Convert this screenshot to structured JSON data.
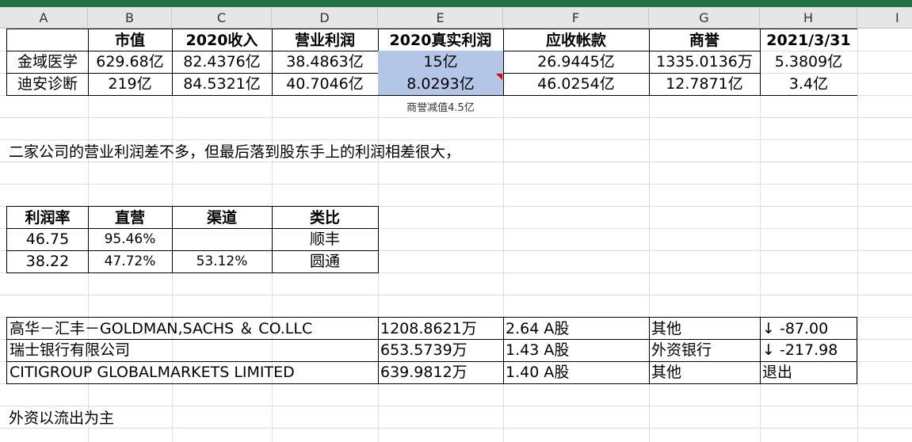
{
  "app": {
    "accent": "#217346",
    "selection_fill": "#b4c6e7",
    "comment_marker": "#e00000"
  },
  "columns": [
    "A",
    "B",
    "C",
    "D",
    "E",
    "F",
    "G",
    "H",
    "I"
  ],
  "table1": {
    "headers": [
      "",
      "市值",
      "2020收入",
      "营业利润",
      "2020真实利润",
      "应收帐款",
      "商誉",
      "2021/3/31"
    ],
    "rows": [
      [
        "金域医学",
        "629.68亿",
        "82.4376亿",
        "38.4863亿",
        "15亿",
        "26.9445亿",
        "1335.0136万",
        "5.3809亿"
      ],
      [
        "迪安诊断",
        "219亿",
        "84.5321亿",
        "40.7046亿",
        "8.0293亿",
        "46.0254亿",
        "12.7871亿",
        "3.4亿"
      ]
    ],
    "note": "商誉减值4.5亿"
  },
  "remark1": "二家公司的营业利润差不多，但最后落到股东手上的利润相差很大，",
  "table2": {
    "headers": [
      "利润率",
      "直营",
      "渠道",
      "类比"
    ],
    "rows": [
      [
        "46.75",
        "95.46%",
        "",
        "顺丰"
      ],
      [
        "38.22",
        "47.72%",
        "53.12%",
        "圆通"
      ]
    ]
  },
  "table3": {
    "rows": [
      [
        "高华－汇丰－GOLDMAN,SACHS ＆ CO.LLC",
        "1208.8621万",
        "2.64 A股",
        "其他",
        "↓ -87.00"
      ],
      [
        "瑞士银行有限公司",
        "653.5739万",
        "1.43 A股",
        "外资银行",
        "↓ -217.98"
      ],
      [
        "CITIGROUP GLOBALMARKETS LIMITED",
        "639.9812万",
        "1.40 A股",
        "其他",
        "退出"
      ]
    ]
  },
  "remark2": "外资以流出为主"
}
